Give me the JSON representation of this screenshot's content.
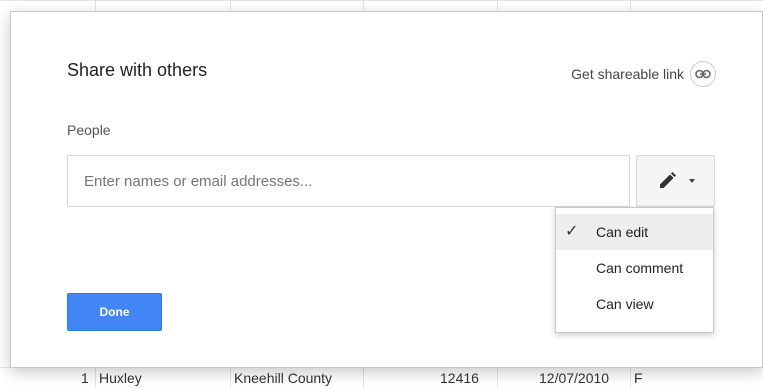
{
  "sheet": {
    "row": {
      "num": "1",
      "name": "Huxley",
      "county": "Kneehill County",
      "value": "12416",
      "date": "12/07/2010",
      "flag": "F"
    }
  },
  "dialog": {
    "title": "Share with others",
    "shareable_link": "Get shareable link",
    "people_label": "People",
    "input_placeholder": "Enter names or email addresses...",
    "done_label": "Done",
    "accent_color": "#4285f4"
  },
  "permission_menu": {
    "items": [
      {
        "label": "Can edit",
        "selected": true
      },
      {
        "label": "Can comment",
        "selected": false
      },
      {
        "label": "Can view",
        "selected": false
      }
    ],
    "check_glyph": "✓"
  }
}
